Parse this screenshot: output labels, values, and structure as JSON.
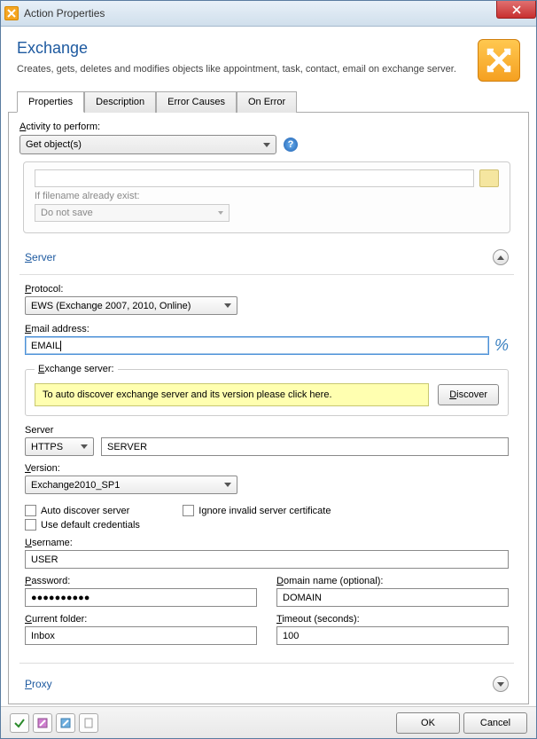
{
  "window": {
    "title": "Action Properties"
  },
  "header": {
    "title": "Exchange",
    "description": "Creates, gets, deletes and modifies objects like appointment, task, contact, email on exchange server."
  },
  "tabs": {
    "t0": "Properties",
    "t1": "Description",
    "t2": "Error Causes",
    "t3": "On Error"
  },
  "activity": {
    "label": "Activity to perform:",
    "value": "Get object(s)"
  },
  "faded": {
    "filename_label": "If filename already exist:",
    "filename_value": "Do not save"
  },
  "server": {
    "section": "Server",
    "protocol_label": "Protocol:",
    "protocol_value": "EWS (Exchange 2007, 2010, Online)",
    "email_label": "Email address:",
    "email_value": "EMAIL",
    "exchange_legend": "Exchange server:",
    "discover_note": "To auto discover exchange server and its version please click here.",
    "discover_btn": "Discover",
    "server_label": "Server",
    "server_proto": "HTTPS",
    "server_host": "SERVER",
    "version_label": "Version:",
    "version_value": "Exchange2010_SP1",
    "auto_discover": "Auto discover server",
    "ignore_cert": "Ignore invalid server certificate",
    "use_default": "Use default credentials",
    "username_label": "Username:",
    "username_value": "USER",
    "password_label": "Password:",
    "password_value": "●●●●●●●●●●",
    "domain_label": "Domain name (optional):",
    "domain_value": "DOMAIN",
    "folder_label": "Current folder:",
    "folder_value": "Inbox",
    "timeout_label": "Timeout (seconds):",
    "timeout_value": "100"
  },
  "proxy": {
    "section": "Proxy"
  },
  "footer": {
    "ok": "OK",
    "cancel": "Cancel"
  }
}
